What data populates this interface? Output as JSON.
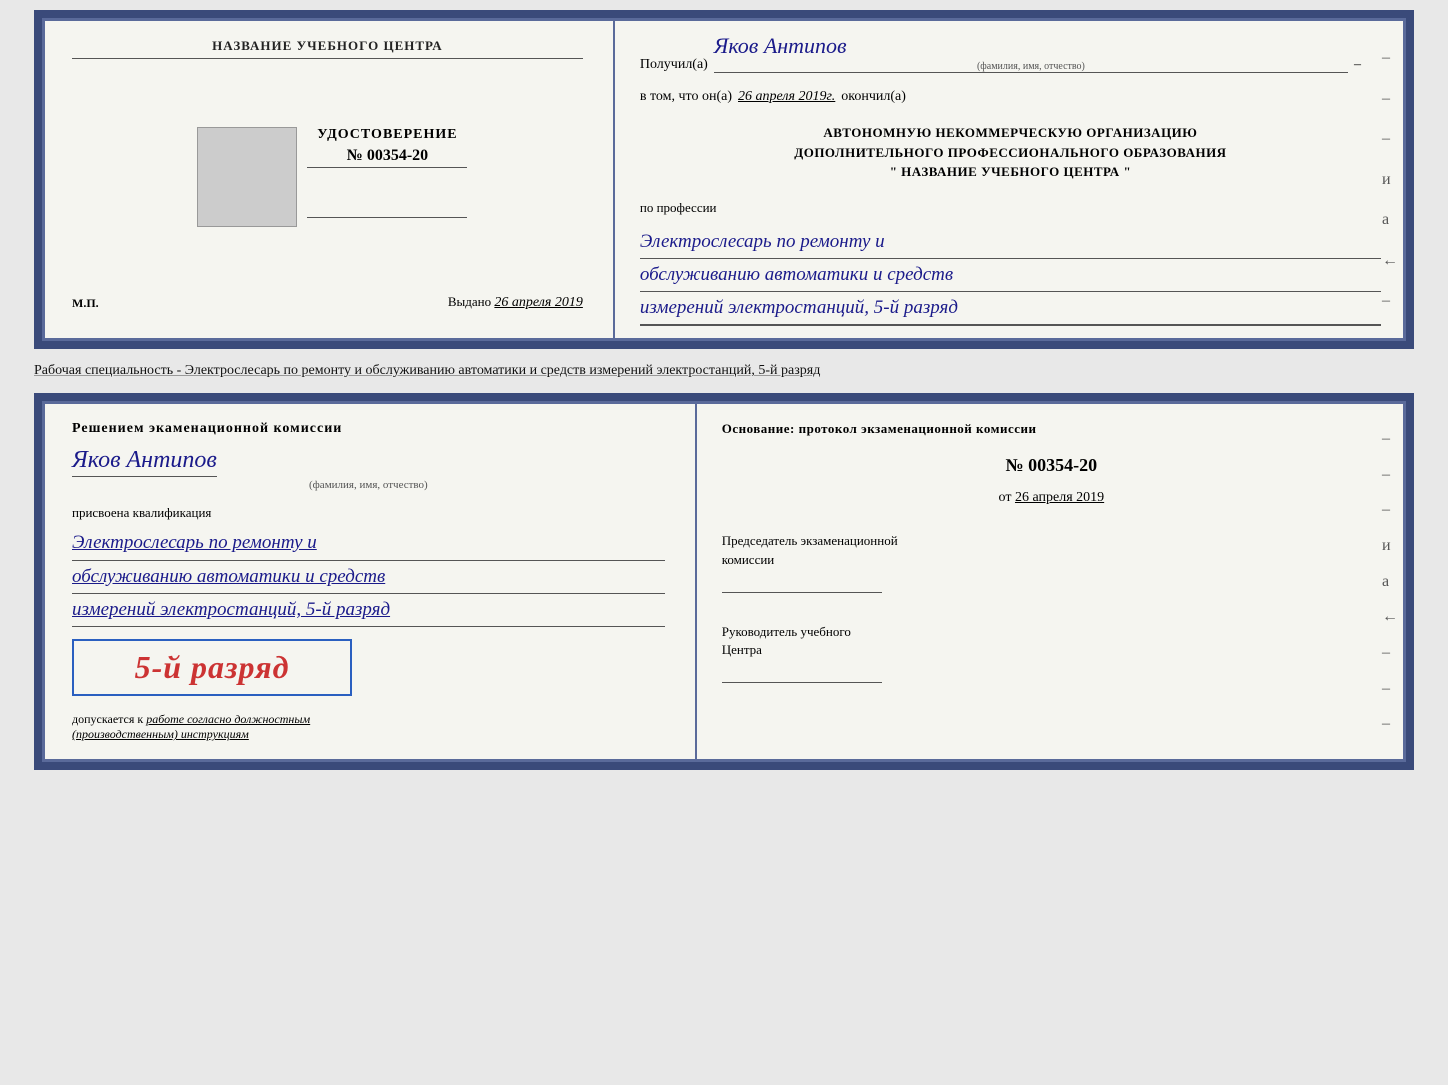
{
  "topDoc": {
    "left": {
      "orgName": "НАЗВАНИЕ УЧЕБНОГО ЦЕНТРА",
      "certTitle": "УДОСТОВЕРЕНИЕ",
      "certNumber": "№ 00354-20",
      "issuedLabel": "Выдано",
      "issuedDate": "26 апреля 2019",
      "mpLabel": "М.П."
    },
    "right": {
      "recipientLabel": "Получил(а)",
      "recipientName": "Яков Антипов",
      "fioHint": "(фамилия, имя, отчество)",
      "completedLabel": "в том, что он(а)",
      "completedDate": "26 апреля 2019г.",
      "completedWord": "окончил(а)",
      "orgLine1": "АВТОНОМНУЮ НЕКОММЕРЧЕСКУЮ ОРГАНИЗАЦИЮ",
      "orgLine2": "ДОПОЛНИТЕЛЬНОГО ПРОФЕССИОНАЛЬНОГО ОБРАЗОВАНИЯ",
      "orgLine3": "\"  НАЗВАНИЕ УЧЕБНОГО ЦЕНТРА  \"",
      "professionLabel": "по профессии",
      "professionLine1": "Электрослесарь по ремонту и",
      "professionLine2": "обслуживанию автоматики и средств",
      "professionLine3": "измерений электростанций, 5-й разряд",
      "dashes": [
        "-",
        "-",
        "-",
        "и",
        "а",
        "←",
        "-"
      ]
    }
  },
  "separator": {
    "text": "Рабочая специальность - Электрослесарь по ремонту и обслуживанию автоматики и средств измерений электростанций, 5-й разряд"
  },
  "bottomDoc": {
    "left": {
      "decisionText": "Решением экаменационной комиссии",
      "personName": "Яков Антипов",
      "fioHint": "(фамилия, имя, отчество)",
      "assignedLabel": "присвоена квалификация",
      "qualLine1": "Электрослесарь по ремонту и",
      "qualLine2": "обслуживанию автоматики и средств",
      "qualLine3": "измерений электростанций, 5-й разряд",
      "rankBadge": "5-й разряд",
      "allowedLabel": "допускается к",
      "allowedValue": "работе согласно должностным",
      "allowedValue2": "(производственным) инструкциям"
    },
    "right": {
      "basisLabel": "Основание: протокол экзаменационной комиссии",
      "protocolNumber": "№  00354-20",
      "fromLabel": "от",
      "fromDate": "26 апреля 2019",
      "chairLabel": "Председатель экзаменационной",
      "chairLabel2": "комиссии",
      "headLabel": "Руководитель учебного",
      "headLabel2": "Центра",
      "dashes": [
        "-",
        "-",
        "-",
        "и",
        "а",
        "←",
        "-",
        "-",
        "-"
      ]
    }
  }
}
